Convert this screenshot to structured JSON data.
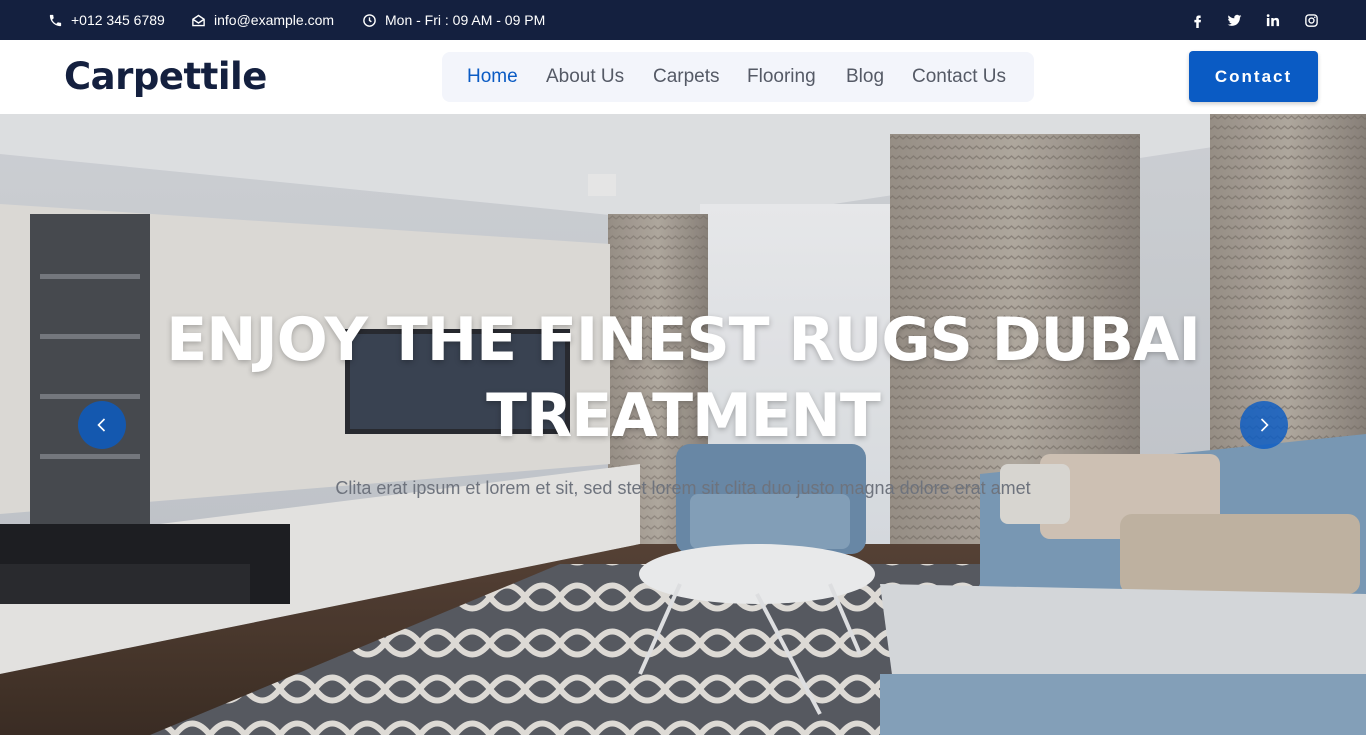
{
  "topbar": {
    "phone": "+012 345 6789",
    "email": "info@example.com",
    "hours": "Mon - Fri : 09 AM - 09 PM",
    "icons": [
      "phone-icon",
      "envelope-icon",
      "clock-icon",
      "facebook-icon",
      "twitter-icon",
      "linkedin-icon",
      "instagram-icon"
    ],
    "background": "#14203f"
  },
  "navbar": {
    "brand": "Carpettile",
    "menu": [
      {
        "label": "Home",
        "active": true
      },
      {
        "label": "About Us",
        "active": false
      },
      {
        "label": "Carpets",
        "active": false
      },
      {
        "label": "Flooring",
        "active": false
      },
      {
        "label": "Blog",
        "active": false
      },
      {
        "label": "Contact Us",
        "active": false
      }
    ],
    "contact_button": "Contact",
    "accent": "#0a5bc4"
  },
  "hero": {
    "title": "ENJOY THE FINEST RUGS DUBAI TREATMENT",
    "subtitle": "Clita erat ipsum et lorem et sit, sed stet lorem sit clita duo justo magna dolore erat amet",
    "prev_icon": "chevron-left-icon",
    "next_icon": "chevron-right-icon"
  }
}
